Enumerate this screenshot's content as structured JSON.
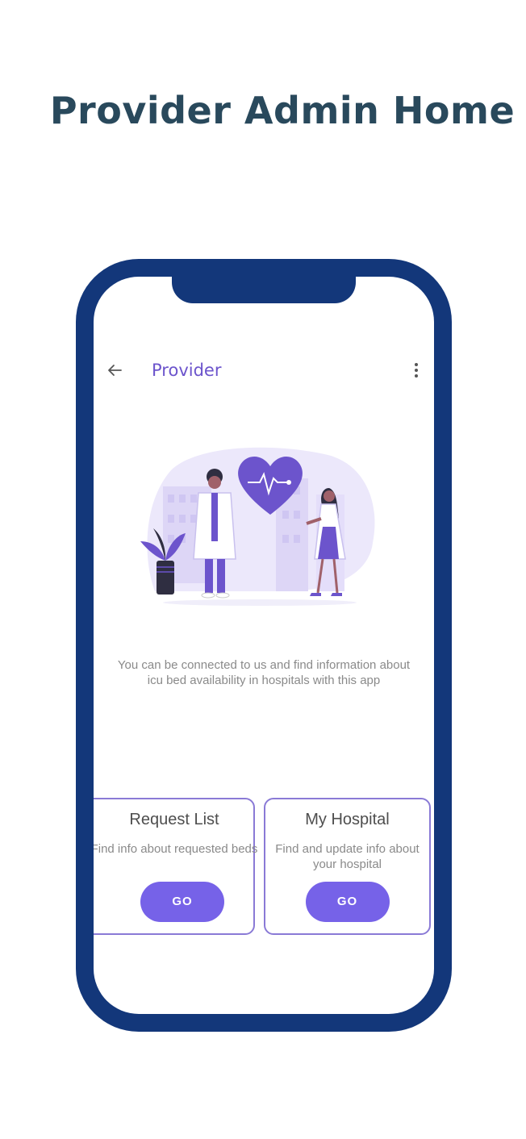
{
  "page": {
    "title": "Provider Admin Home"
  },
  "appbar": {
    "title": "Provider",
    "back_icon": "arrow-back-icon",
    "menu_icon": "more-vertical-icon"
  },
  "main": {
    "description": "You can be connected to us and find information about icu bed availability in hospitals with this app"
  },
  "cards": [
    {
      "title": "Request List",
      "description": "Find info about requested beds",
      "button_label": "GO"
    },
    {
      "title": "My Hospital",
      "description": "Find and update info about your hospital",
      "button_label": "GO"
    }
  ],
  "colors": {
    "title_text": "#29495c",
    "phone_frame": "#13377a",
    "accent": "#6c54cc",
    "button": "#7662e8",
    "card_border": "#8a7ad6"
  }
}
